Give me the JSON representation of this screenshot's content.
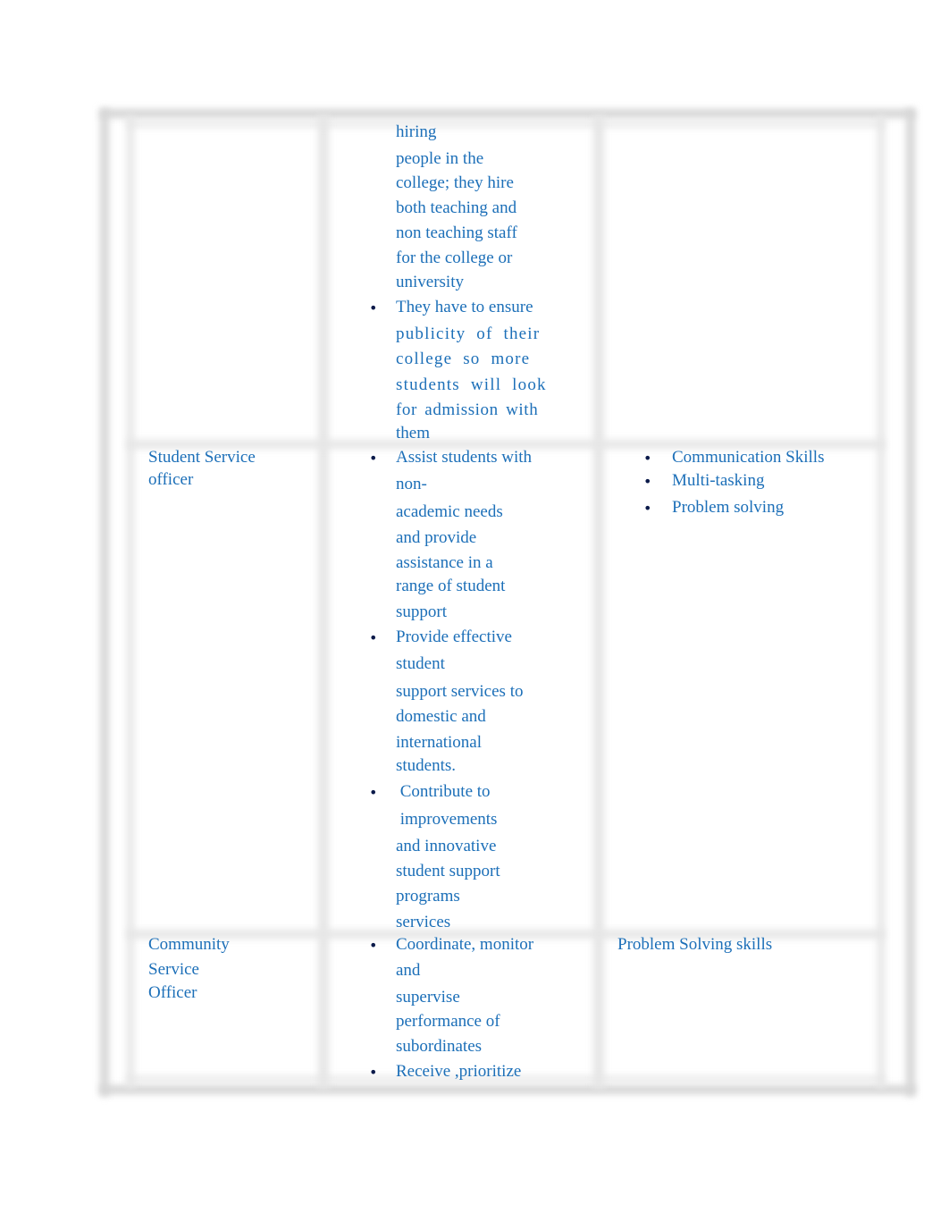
{
  "document": {
    "table": {
      "rows": [
        {
          "role": "",
          "responsibilities": [
            {
              "bulleted": false,
              "lines": [
                "hiring",
                "people in the",
                "college; they hire",
                "both teaching and",
                "non teaching staff",
                "for the college or",
                "university"
              ]
            },
            {
              "bulleted": true,
              "lines": [
                "They have to ensure",
                "publicity  of  their",
                "college  so  more",
                "students  will  look",
                "for admission with",
                "them"
              ]
            }
          ],
          "skills": []
        },
        {
          "role_lines": [
            "Student Service",
            "officer"
          ],
          "responsibilities": [
            {
              "bulleted": true,
              "lines": [
                "Assist students with",
                "non-",
                "academic needs",
                "and provide",
                "assistance in a",
                "range of student",
                "support"
              ]
            },
            {
              "bulleted": true,
              "lines": [
                "Provide effective",
                "student",
                "support services to",
                "domestic and",
                "international",
                "students."
              ]
            },
            {
              "bulleted": true,
              "lines": [
                " Contribute to",
                " improvements",
                "and innovative",
                "student support",
                "programs",
                "services"
              ]
            }
          ],
          "skills": [
            "Communication Skills",
            "Multi-tasking",
            "Problem solving"
          ]
        },
        {
          "role_lines": [
            "Community",
            "Service",
            "Officer"
          ],
          "responsibilities": [
            {
              "bulleted": true,
              "lines": [
                "Coordinate, monitor",
                "and",
                "supervise",
                "performance of",
                "subordinates"
              ]
            },
            {
              "bulleted": true,
              "lines": [
                "Receive ,prioritize"
              ]
            }
          ],
          "skills_plain": "Problem Solving skills"
        }
      ]
    },
    "bullet_glyph": "•",
    "colors": {
      "text": "#1c6fb8",
      "bullet": "#0b1a4a",
      "border": "#d6d6d6"
    }
  }
}
